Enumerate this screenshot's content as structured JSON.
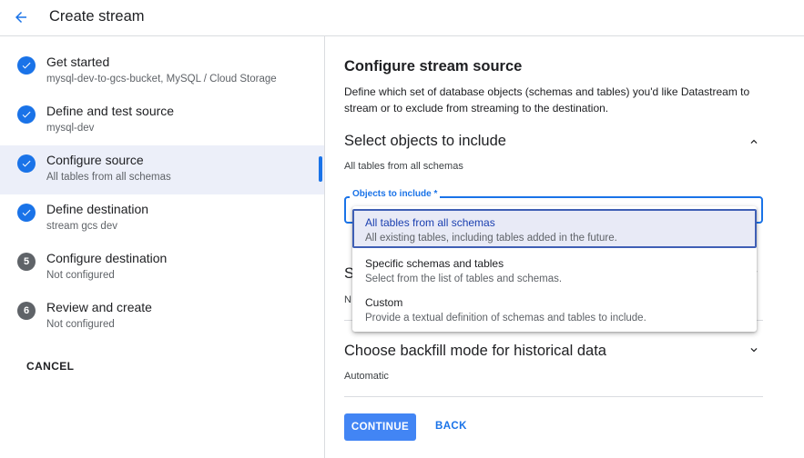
{
  "header": {
    "title": "Create stream"
  },
  "steps": [
    {
      "title": "Get started",
      "subtitle": "mysql-dev-to-gcs-bucket, MySQL / Cloud Storage",
      "state": "done"
    },
    {
      "title": "Define and test source",
      "subtitle": "mysql-dev",
      "state": "done"
    },
    {
      "title": "Configure source",
      "subtitle": "All tables from all schemas",
      "state": "done-active"
    },
    {
      "title": "Define destination",
      "subtitle": "stream gcs dev",
      "state": "done"
    },
    {
      "title": "Configure destination",
      "subtitle": "Not configured",
      "state": "pending",
      "number": "5"
    },
    {
      "title": "Review and create",
      "subtitle": "Not configured",
      "state": "pending",
      "number": "6"
    }
  ],
  "sidebar": {
    "cancel_label": "CANCEL"
  },
  "main": {
    "title": "Configure stream source",
    "description": "Define which set of database objects (schemas and tables) you'd like Datastream to stream or to exclude from streaming to the destination.",
    "include_section": {
      "title": "Select objects to include",
      "summary": "All tables from all schemas",
      "field_label": "Objects to include *"
    },
    "hidden_section_fragment": "S",
    "hidden_summary_fragment": "N",
    "backfill_section": {
      "title": "Choose backfill mode for historical data",
      "summary": "Automatic"
    },
    "continue_label": "CONTINUE",
    "back_label": "BACK"
  },
  "menu": {
    "options": [
      {
        "title": "All tables from all schemas",
        "subtitle": "All existing tables, including tables added in the future.",
        "selected": true
      },
      {
        "title": "Specific schemas and tables",
        "subtitle": "Select from the list of tables and schemas.",
        "selected": false
      },
      {
        "title": "Custom",
        "subtitle": "Provide a textual definition of schemas and tables to include.",
        "selected": false
      }
    ]
  },
  "colors": {
    "accent": "#1a73e8",
    "button": "#4285f4",
    "selected_bg": "#e8eaf6"
  }
}
